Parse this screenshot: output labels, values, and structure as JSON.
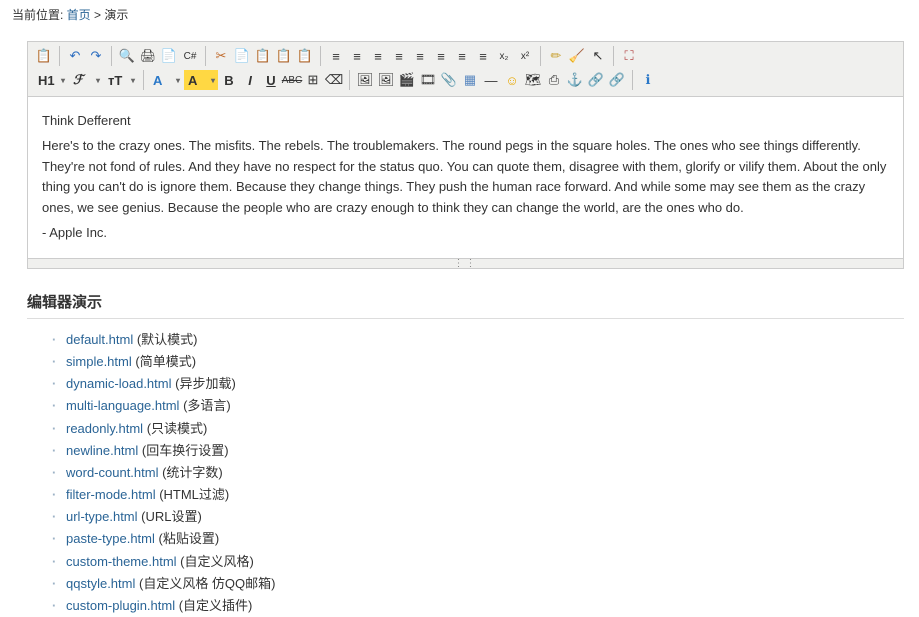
{
  "breadcrumb": {
    "prefix": "当前位置:  ",
    "home": "首页",
    "sep": "  >  ",
    "current": "演示"
  },
  "toolbar_row1": [
    {
      "name": "source-icon",
      "glyph": "📋"
    },
    {
      "sep": true
    },
    {
      "name": "undo-icon",
      "glyph": "↶",
      "color": "#2a6cbf"
    },
    {
      "name": "redo-icon",
      "glyph": "↷",
      "color": "#2a6cbf"
    },
    {
      "sep": true
    },
    {
      "name": "preview-icon",
      "glyph": "🔍"
    },
    {
      "name": "print-icon",
      "glyph": "🖨"
    },
    {
      "name": "template-icon",
      "glyph": "📄"
    },
    {
      "name": "code-icon",
      "glyph": "C#",
      "small": true
    },
    {
      "sep": true
    },
    {
      "name": "cut-icon",
      "glyph": "✂",
      "color": "#c06a2b"
    },
    {
      "name": "copy-icon",
      "glyph": "📄"
    },
    {
      "name": "paste-icon",
      "glyph": "📋"
    },
    {
      "name": "paste-text-icon",
      "glyph": "📋"
    },
    {
      "name": "paste-word-icon",
      "glyph": "📋"
    },
    {
      "sep": true
    },
    {
      "name": "align-left-icon",
      "glyph": "≡",
      "align": "left"
    },
    {
      "name": "align-center-icon",
      "glyph": "≡",
      "align": "center"
    },
    {
      "name": "align-right-icon",
      "glyph": "≡",
      "align": "right"
    },
    {
      "name": "justify-icon",
      "glyph": "≡"
    },
    {
      "name": "list-ol-icon",
      "glyph": "≡"
    },
    {
      "name": "list-ul-icon",
      "glyph": "≡"
    },
    {
      "name": "outdent-icon",
      "glyph": "≡"
    },
    {
      "name": "indent-icon",
      "glyph": "≡"
    },
    {
      "name": "subscript-icon",
      "glyph": "x₂",
      "small": true
    },
    {
      "name": "superscript-icon",
      "glyph": "x²",
      "small": true
    },
    {
      "sep": true
    },
    {
      "name": "eyedrop-icon",
      "glyph": "✏",
      "color": "#c8a030"
    },
    {
      "name": "erase-icon",
      "glyph": "🧹"
    },
    {
      "name": "select-icon",
      "glyph": "↖"
    },
    {
      "sep": true
    },
    {
      "name": "fullscreen-icon",
      "glyph": "⛶",
      "color": "#b04040"
    }
  ],
  "toolbar_row2": [
    {
      "name": "heading-dropdown",
      "glyph": "H1",
      "dd": true
    },
    {
      "name": "fontname-dropdown",
      "glyph": "ℱ",
      "dd": true,
      "italic": true
    },
    {
      "name": "fontsize-dropdown",
      "glyph": "ᴛT",
      "dd": true
    },
    {
      "sep": true
    },
    {
      "name": "textcolor-dropdown",
      "glyph": "A",
      "dd": true,
      "color": "#2a78c8"
    },
    {
      "name": "bgcolor-dropdown",
      "glyph": "A",
      "dd": true,
      "hl": true
    },
    {
      "name": "bold-icon",
      "glyph": "B",
      "bold": true
    },
    {
      "name": "italic-icon",
      "glyph": "I",
      "italic": true,
      "bold": true
    },
    {
      "name": "underline-icon",
      "glyph": "U",
      "under": true,
      "bold": true
    },
    {
      "name": "strike-icon",
      "glyph": "ABC",
      "strike": true,
      "small": true
    },
    {
      "name": "border-icon",
      "glyph": "⊞"
    },
    {
      "name": "clearformat-icon",
      "glyph": "⌫"
    },
    {
      "sep": true
    },
    {
      "name": "image-icon",
      "glyph": "🖼"
    },
    {
      "name": "multiimage-icon",
      "glyph": "🖼"
    },
    {
      "name": "flash-icon",
      "glyph": "🎬"
    },
    {
      "name": "media-icon",
      "glyph": "🎞"
    },
    {
      "name": "file-icon",
      "glyph": "📎"
    },
    {
      "name": "table-icon",
      "glyph": "▦",
      "color": "#5a88c0"
    },
    {
      "name": "hr-icon",
      "glyph": "—"
    },
    {
      "name": "emoji-icon",
      "glyph": "☺",
      "color": "#e8a800"
    },
    {
      "name": "map-icon",
      "glyph": "🗺"
    },
    {
      "name": "pagebreak-icon",
      "glyph": "⎙"
    },
    {
      "name": "anchor-icon",
      "glyph": "⚓",
      "color": "#888"
    },
    {
      "name": "link-icon",
      "glyph": "🔗"
    },
    {
      "name": "unlink-icon",
      "glyph": "🔗"
    },
    {
      "sep": true
    },
    {
      "name": "about-icon",
      "glyph": "ℹ",
      "color": "#2a78c8"
    }
  ],
  "editor": {
    "title": "Think Defferent",
    "body": "Here's to the crazy ones. The misfits. The rebels. The troublemakers. The round pegs in the square holes. The ones who see things differently. They're not fond of rules. And they have no respect for the status quo. You can quote them, disagree with them, glorify or vilify them. About the only thing you can't do is ignore them. Because they change things. They push the human race forward. And while some may see them as the crazy ones, we see genius. Because the people who are crazy enough to think they can change the world, are the ones who do.",
    "signature": "- Apple Inc."
  },
  "section_title": "编辑器演示",
  "demos": [
    {
      "href": "default.html",
      "desc": "默认模式"
    },
    {
      "href": "simple.html",
      "desc": "简单模式"
    },
    {
      "href": "dynamic-load.html",
      "desc": "异步加载"
    },
    {
      "href": "multi-language.html",
      "desc": "多语言"
    },
    {
      "href": "readonly.html",
      "desc": "只读模式"
    },
    {
      "href": "newline.html",
      "desc": "回车换行设置"
    },
    {
      "href": "word-count.html",
      "desc": "统计字数"
    },
    {
      "href": "filter-mode.html",
      "desc": "HTML过滤"
    },
    {
      "href": "url-type.html",
      "desc": "URL设置"
    },
    {
      "href": "paste-type.html",
      "desc": "粘贴设置"
    },
    {
      "href": "custom-theme.html",
      "desc": "自定义风格"
    },
    {
      "href": "qqstyle.html",
      "desc": "自定义风格 仿QQ邮箱"
    },
    {
      "href": "custom-plugin.html",
      "desc": "自定义插件"
    }
  ]
}
